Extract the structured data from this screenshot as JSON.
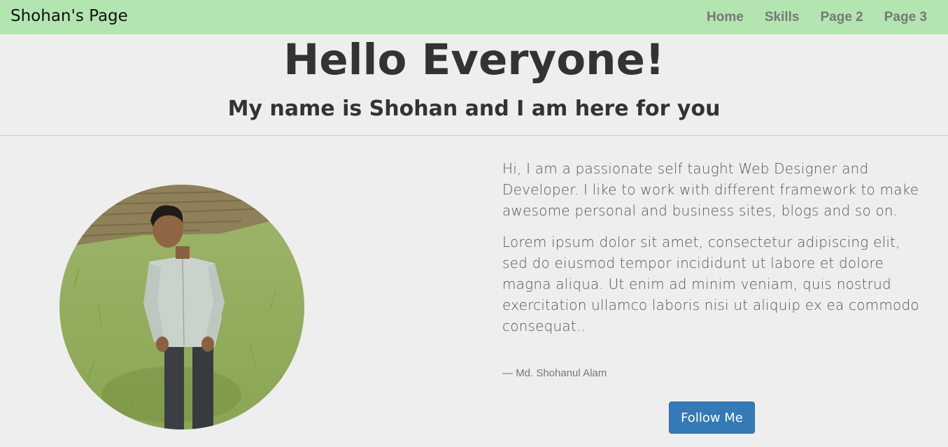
{
  "navbar": {
    "brand": "Shohan's Page",
    "links": [
      "Home",
      "Skills",
      "Page 2",
      "Page 3"
    ],
    "background_color": "#b3e5b0"
  },
  "hero": {
    "title": "Hello Everyone!",
    "subtitle": "My name is Shohan and I am here for you"
  },
  "profile": {
    "photo_icon": "profile-photo"
  },
  "bio": {
    "paragraph_1": "Hi, I am a passionate self taught Web Designer and Developer. I like to work with different framework to make awesome personal and business sites, blogs and so on.",
    "paragraph_2": "Lorem ipsum dolor sit amet, consectetur adipiscing elit, sed do eiusmod tempor incididunt ut labore et dolore magna aliqua. Ut enim ad minim veniam, quis nostrud exercitation ullamco laboris nisi ut aliquip ex ea commodo consequat..",
    "byline": "— Md. Shohanul Alam"
  },
  "cta": {
    "follow_label": "Follow Me",
    "button_color": "#337ab7"
  }
}
